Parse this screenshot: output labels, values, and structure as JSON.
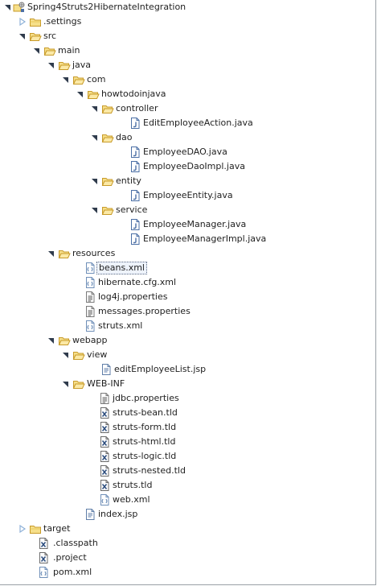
{
  "project_tree": {
    "root": {
      "label": "Spring4Struts2HibernateIntegration",
      "icon": "maven-project-icon"
    },
    "items": [
      {
        "label": ".settings",
        "icon": "folder-icon",
        "expanded": false
      },
      {
        "label": "src",
        "icon": "folder-icon",
        "expanded": true
      },
      {
        "label": "main",
        "icon": "folder-icon",
        "expanded": true
      },
      {
        "label": "java",
        "icon": "folder-icon",
        "expanded": true
      },
      {
        "label": "com",
        "icon": "folder-icon",
        "expanded": true
      },
      {
        "label": "howtodoinjava",
        "icon": "folder-icon",
        "expanded": true
      },
      {
        "label": "controller",
        "icon": "folder-icon",
        "expanded": true
      },
      {
        "label": "EditEmployeeAction.java",
        "icon": "java-file-icon"
      },
      {
        "label": "dao",
        "icon": "folder-icon",
        "expanded": true
      },
      {
        "label": "EmployeeDAO.java",
        "icon": "java-file-icon"
      },
      {
        "label": "EmployeeDaoImpl.java",
        "icon": "java-file-icon"
      },
      {
        "label": "entity",
        "icon": "folder-icon",
        "expanded": true
      },
      {
        "label": "EmployeeEntity.java",
        "icon": "java-file-icon"
      },
      {
        "label": "service",
        "icon": "folder-icon",
        "expanded": true
      },
      {
        "label": "EmployeeManager.java",
        "icon": "java-file-icon"
      },
      {
        "label": "EmployeeManagerImpl.java",
        "icon": "java-file-icon"
      },
      {
        "label": "resources",
        "icon": "folder-icon",
        "expanded": true
      },
      {
        "label": "beans.xml",
        "icon": "xml-file-icon",
        "selected": true
      },
      {
        "label": "hibernate.cfg.xml",
        "icon": "xml-file-icon"
      },
      {
        "label": "log4j.properties",
        "icon": "properties-file-icon"
      },
      {
        "label": "messages.properties",
        "icon": "properties-file-icon"
      },
      {
        "label": "struts.xml",
        "icon": "xml-file-icon"
      },
      {
        "label": "webapp",
        "icon": "folder-icon",
        "expanded": true
      },
      {
        "label": "view",
        "icon": "folder-icon",
        "expanded": true
      },
      {
        "label": "editEmployeeList.jsp",
        "icon": "jsp-file-icon"
      },
      {
        "label": "WEB-INF",
        "icon": "folder-icon",
        "expanded": true
      },
      {
        "label": "jdbc.properties",
        "icon": "properties-file-icon"
      },
      {
        "label": "struts-bean.tld",
        "icon": "tld-file-icon"
      },
      {
        "label": "struts-form.tld",
        "icon": "tld-file-icon"
      },
      {
        "label": "struts-html.tld",
        "icon": "tld-file-icon"
      },
      {
        "label": "struts-logic.tld",
        "icon": "tld-file-icon"
      },
      {
        "label": "struts-nested.tld",
        "icon": "tld-file-icon"
      },
      {
        "label": "struts.tld",
        "icon": "tld-file-icon"
      },
      {
        "label": "web.xml",
        "icon": "xml-file-icon"
      },
      {
        "label": "index.jsp",
        "icon": "jsp-file-icon"
      },
      {
        "label": "target",
        "icon": "folder-icon",
        "expanded": false
      },
      {
        "label": ".classpath",
        "icon": "tld-file-icon"
      },
      {
        "label": ".project",
        "icon": "tld-file-icon"
      },
      {
        "label": "pom.xml",
        "icon": "xml-file-icon"
      }
    ]
  },
  "colors": {
    "folder_fill": "#f6df8a",
    "folder_stroke": "#c89b2a",
    "arrow_expanded": "#2f3b4c",
    "arrow_collapsed": "#8fb2d8",
    "java_icon": "#4b6fa5",
    "xml_icon": "#6f8fb8",
    "jsp_icon": "#5f7ea8",
    "text": "#1f1f1f"
  }
}
